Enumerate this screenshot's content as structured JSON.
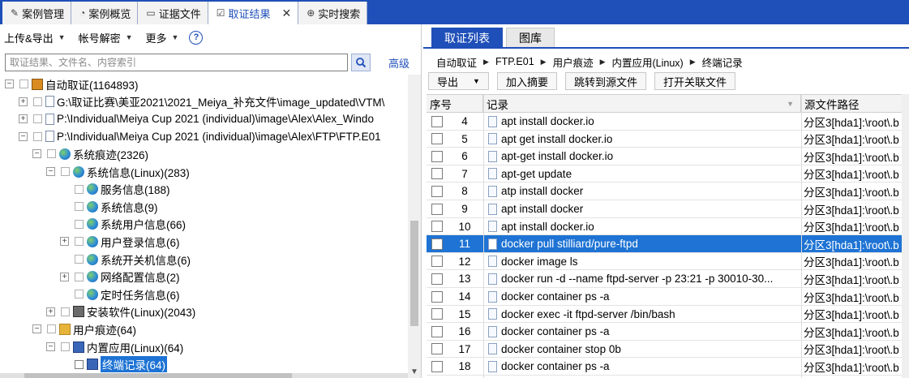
{
  "top_tabs": [
    {
      "label": "案例管理",
      "icon": "edit-icon"
    },
    {
      "label": "案例概览",
      "icon": "overview-icon"
    },
    {
      "label": "证据文件",
      "icon": "document-icon"
    },
    {
      "label": "取证结果",
      "icon": "result-icon",
      "active": true,
      "closable": true
    },
    {
      "label": "实时搜索",
      "icon": "search-icon"
    }
  ],
  "left": {
    "toolbar": {
      "upload_export": "上传&导出",
      "account_decrypt": "帐号解密",
      "more": "更多",
      "help": "?"
    },
    "search": {
      "placeholder": "取证结果、文件名、内容索引",
      "advanced": "高级"
    },
    "tree": [
      {
        "depth": 0,
        "exp": "⊟",
        "icon": "root",
        "label": "自动取证(1164893)"
      },
      {
        "depth": 1,
        "exp": "⊞",
        "icon": "file",
        "label": "G:\\取证比赛\\美亚2021\\2021_Meiya_补充文件\\image_updated\\VTM\\"
      },
      {
        "depth": 1,
        "exp": "⊞",
        "icon": "file",
        "label": "P:\\Individual\\Meiya Cup 2021 (individual)\\image\\Alex\\Alex_Windo"
      },
      {
        "depth": 1,
        "exp": "⊟",
        "icon": "file",
        "label": "P:\\Individual\\Meiya Cup 2021 (individual)\\image\\Alex\\FTP\\FTP.E01"
      },
      {
        "depth": 2,
        "exp": "⊟",
        "icon": "globe",
        "label": "系统痕迹(2326)"
      },
      {
        "depth": 3,
        "exp": "⊟",
        "icon": "globe",
        "label": "系统信息(Linux)(283)"
      },
      {
        "depth": 4,
        "exp": "",
        "icon": "globe",
        "label": "服务信息(188)"
      },
      {
        "depth": 4,
        "exp": "",
        "icon": "globe",
        "label": "系统信息(9)"
      },
      {
        "depth": 4,
        "exp": "",
        "icon": "globe",
        "label": "系统用户信息(66)"
      },
      {
        "depth": 4,
        "exp": "⊞",
        "icon": "globe",
        "label": "用户登录信息(6)"
      },
      {
        "depth": 4,
        "exp": "",
        "icon": "globe",
        "label": "系统开关机信息(6)"
      },
      {
        "depth": 4,
        "exp": "⊞",
        "icon": "globe",
        "label": "网络配置信息(2)"
      },
      {
        "depth": 4,
        "exp": "",
        "icon": "globe",
        "label": "定时任务信息(6)"
      },
      {
        "depth": 3,
        "exp": "⊞",
        "icon": "soft",
        "label": "安装软件(Linux)(2043)"
      },
      {
        "depth": 2,
        "exp": "⊟",
        "icon": "folder",
        "label": "用户痕迹(64)"
      },
      {
        "depth": 3,
        "exp": "⊟",
        "icon": "blue",
        "label": "内置应用(Linux)(64)"
      },
      {
        "depth": 4,
        "exp": "",
        "icon": "blue",
        "label": "终端记录(64)",
        "selected": true
      }
    ]
  },
  "right": {
    "tabs": [
      {
        "label": "取证列表",
        "active": true
      },
      {
        "label": "图库"
      }
    ],
    "breadcrumb": [
      "自动取证",
      "FTP.E01",
      "用户痕迹",
      "内置应用(Linux)",
      "终端记录"
    ],
    "toolbar": {
      "export": "导出",
      "add_summary": "加入摘要",
      "goto_source": "跳转到源文件",
      "open_related": "打开关联文件"
    },
    "columns": {
      "seq": "序号",
      "record": "记录",
      "source": "源文件路径"
    },
    "rows": [
      {
        "seq": "4",
        "record": "apt install docker.io",
        "source": "分区3[hda1]:\\root\\.b"
      },
      {
        "seq": "5",
        "record": "apt get install docker.io",
        "source": "分区3[hda1]:\\root\\.b"
      },
      {
        "seq": "6",
        "record": "apt-get install docker.io",
        "source": "分区3[hda1]:\\root\\.b"
      },
      {
        "seq": "7",
        "record": "apt-get update",
        "source": "分区3[hda1]:\\root\\.b"
      },
      {
        "seq": "8",
        "record": "atp install docker",
        "source": "分区3[hda1]:\\root\\.b"
      },
      {
        "seq": "9",
        "record": "apt install docker",
        "source": "分区3[hda1]:\\root\\.b"
      },
      {
        "seq": "10",
        "record": "apt install docker.io",
        "source": "分区3[hda1]:\\root\\.b"
      },
      {
        "seq": "11",
        "record": "docker pull stilliard/pure-ftpd",
        "source": "分区3[hda1]:\\root\\.b",
        "selected": true
      },
      {
        "seq": "12",
        "record": "docker image ls",
        "source": "分区3[hda1]:\\root\\.b"
      },
      {
        "seq": "13",
        "record": "docker run -d --name ftpd-server -p 23:21 -p 30010-30...",
        "source": "分区3[hda1]:\\root\\.b"
      },
      {
        "seq": "14",
        "record": "docker container ps -a",
        "source": "分区3[hda1]:\\root\\.b"
      },
      {
        "seq": "15",
        "record": "docker exec -it ftpd-server /bin/bash",
        "source": "分区3[hda1]:\\root\\.b"
      },
      {
        "seq": "16",
        "record": "docker container ps -a",
        "source": "分区3[hda1]:\\root\\.b"
      },
      {
        "seq": "17",
        "record": "docker container stop 0b",
        "source": "分区3[hda1]:\\root\\.b"
      },
      {
        "seq": "18",
        "record": "docker container ps -a",
        "source": "分区3[hda1]:\\root\\.b"
      }
    ]
  },
  "colors": {
    "accent": "#1f4fb8",
    "selection": "#1e73d4",
    "link": "#1f4fb8"
  }
}
